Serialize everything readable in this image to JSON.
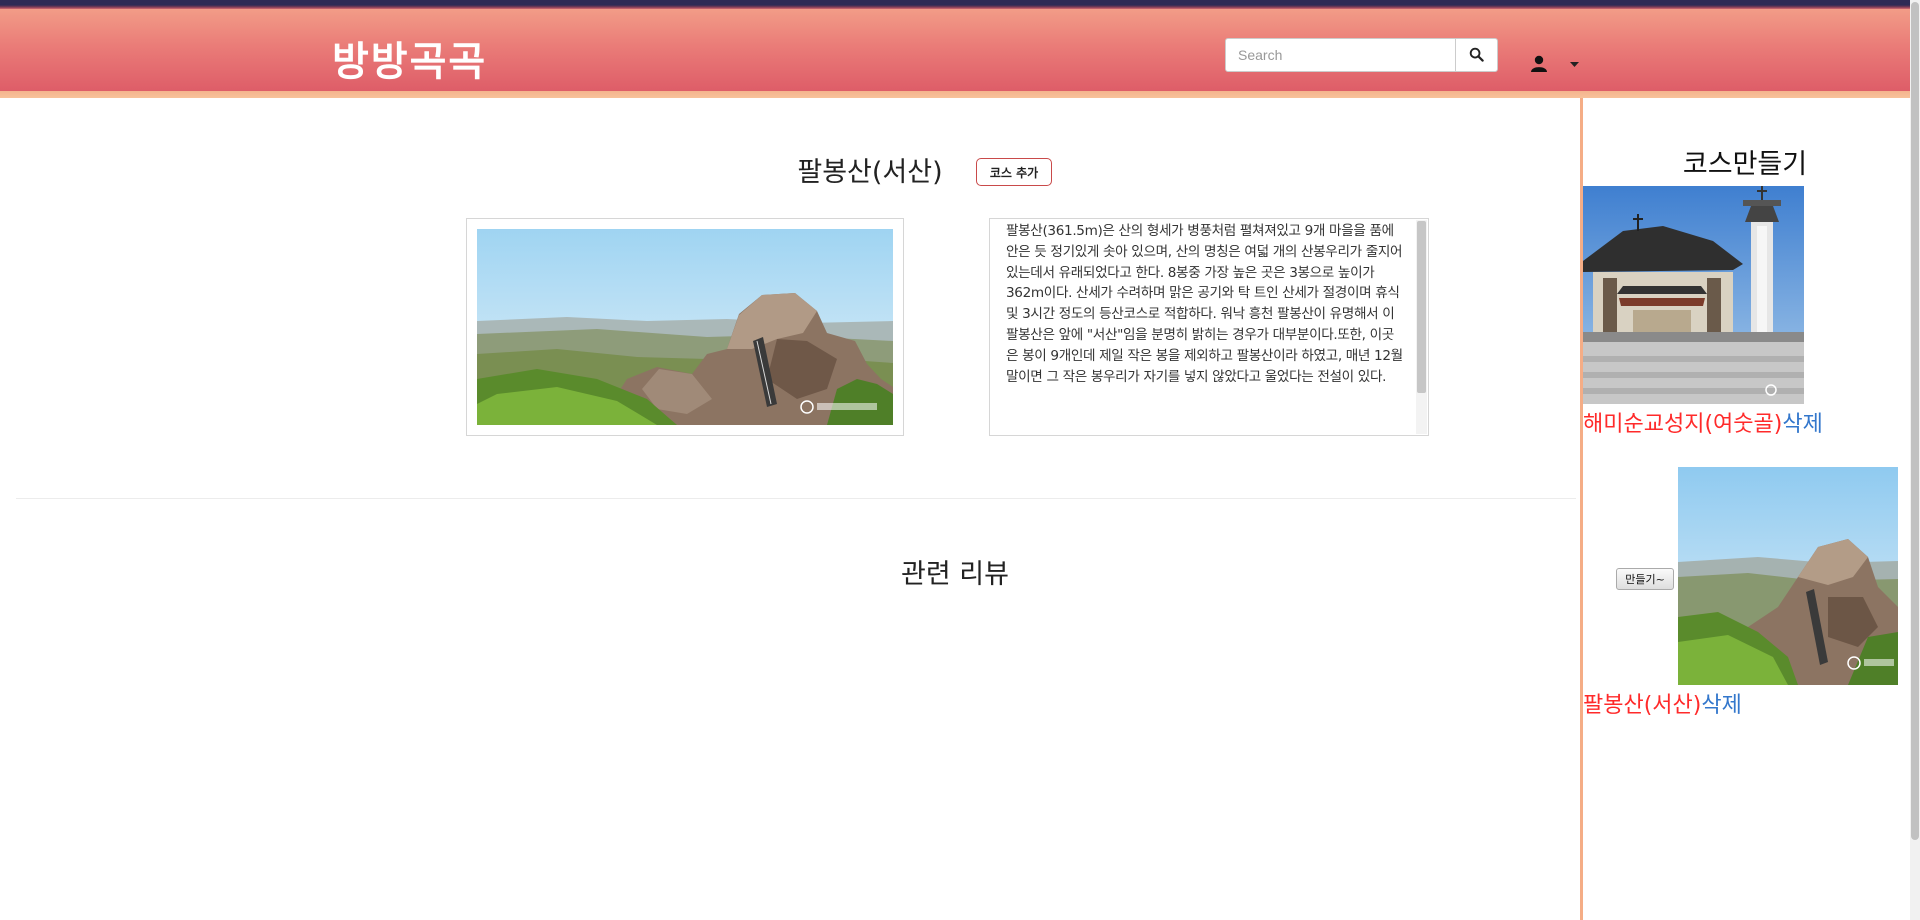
{
  "header": {
    "brand": "방방곡곡",
    "search_placeholder": "Search",
    "search_icon": "search-icon",
    "user_icon": "user-icon",
    "caret_icon": "caret-down-icon"
  },
  "place": {
    "title": "팔봉산(서산)",
    "add_course_label": "코스 추가",
    "description": "팔봉산(361.5m)은 산의 형세가 병풍처럼 펼쳐져있고 9개 마을을 품에 안은 듯 정기있게 솟아 있으며, 산의 명칭은 여덟 개의 산봉우리가 줄지어 있는데서 유래되었다고 한다. 8봉중 가장 높은 곳은 3봉으로 높이가 362m이다. 산세가 수려하며 맑은 공기와 탁 트인 산세가 절경이며 휴식 및 3시간 정도의 등산코스로 적합하다. 워낙 흥천 팔봉산이 유명해서 이 팔봉산은 앞에 \"서산\"임을 분명히 밝히는 경우가 대부분이다.또한, 이곳은 봉이 9개인데 제일 작은 봉을 제외하고 팔봉산이라 하였고, 매년 12월 말이면 그 작은 봉우리가 자기를 넣지 않았다고 울었다는 전설이 있다."
  },
  "reviews": {
    "title": "관련 리뷰"
  },
  "sidebar": {
    "title": "코스만들기",
    "make_button_label": "만들기~",
    "courses": [
      {
        "name": "해미순교성지(여숫골)",
        "delete_label": "삭제"
      },
      {
        "name": "팔봉산(서산)",
        "delete_label": "삭제"
      }
    ]
  },
  "colors": {
    "navbar_top": "#f29c87",
    "navbar_bottom": "#de5d68",
    "accent_divider": "#f5ad86",
    "course_name": "#ff2a2a",
    "delete_link": "#3377cc"
  }
}
